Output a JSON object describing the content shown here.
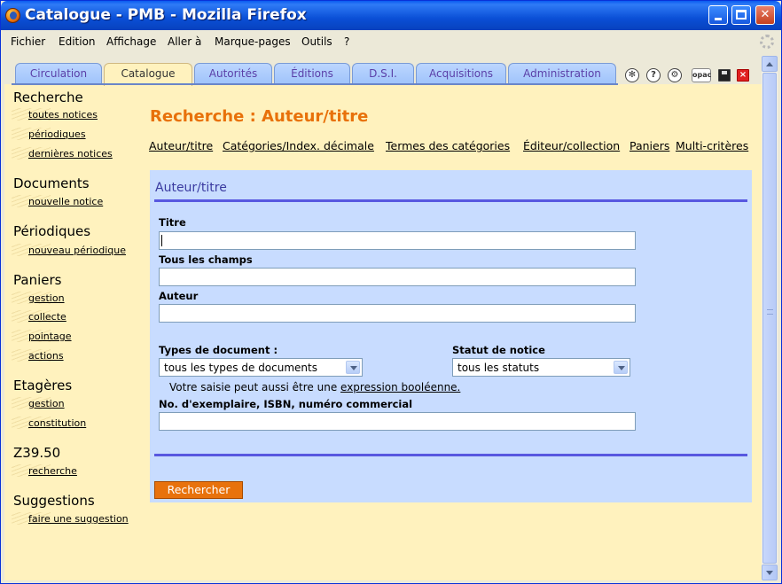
{
  "window": {
    "title": "Catalogue - PMB - Mozilla Firefox"
  },
  "menubar": [
    "Fichier",
    "Edition",
    "Affichage",
    "Aller à",
    "Marque-pages",
    "Outils",
    "?"
  ],
  "tabs": [
    "Circulation",
    "Catalogue",
    "Autorités",
    "Éditions",
    "D.S.I.",
    "Acquisitions",
    "Administration"
  ],
  "active_tab": "Catalogue",
  "toolbar_icons": {
    "opac": "opac",
    "help": "?",
    "logout": "×"
  },
  "sidebar": [
    {
      "heading": "Recherche",
      "links": [
        "toutes notices",
        "périodiques",
        "dernières notices"
      ]
    },
    {
      "heading": "Documents",
      "links": [
        "nouvelle notice"
      ]
    },
    {
      "heading": "Périodiques",
      "links": [
        "nouveau périodique"
      ]
    },
    {
      "heading": "Paniers",
      "links": [
        "gestion",
        "collecte",
        "pointage",
        "actions"
      ]
    },
    {
      "heading": "Etagères",
      "links": [
        "gestion",
        "constitution"
      ]
    },
    {
      "heading": "Z39.50",
      "links": [
        "recherche"
      ]
    },
    {
      "heading": "Suggestions",
      "links": [
        "faire une suggestion"
      ]
    }
  ],
  "main": {
    "title": "Recherche : Auteur/titre",
    "sublinks": [
      "Auteur/titre",
      "Catégories/Index. décimale",
      "Termes des catégories",
      "Éditeur/collection",
      "Paniers",
      "Multi-critères"
    ]
  },
  "form": {
    "title": "Auteur/titre",
    "titre_label": "Titre",
    "titre_value": "",
    "tous_champs_label": "Tous les champs",
    "tous_champs_value": "",
    "auteur_label": "Auteur",
    "auteur_value": "",
    "hint_prefix": "Votre saisie peut aussi être une ",
    "hint_link": "expression booléenne.",
    "doc_type_label": "Types de document :",
    "doc_type_value": "tous les types de documents",
    "statut_label": "Statut de notice",
    "statut_value": "tous les statuts",
    "exemplaire_label": "No. d'exemplaire, ISBN, numéro commercial",
    "exemplaire_value": "",
    "search_button": "Rechercher"
  },
  "colors": {
    "title_orange": "#e8710a",
    "content_bg": "#fff2be",
    "form_bg": "#c8dcff",
    "rule_blue": "#5858e0",
    "button_orange": "#e8720c"
  }
}
